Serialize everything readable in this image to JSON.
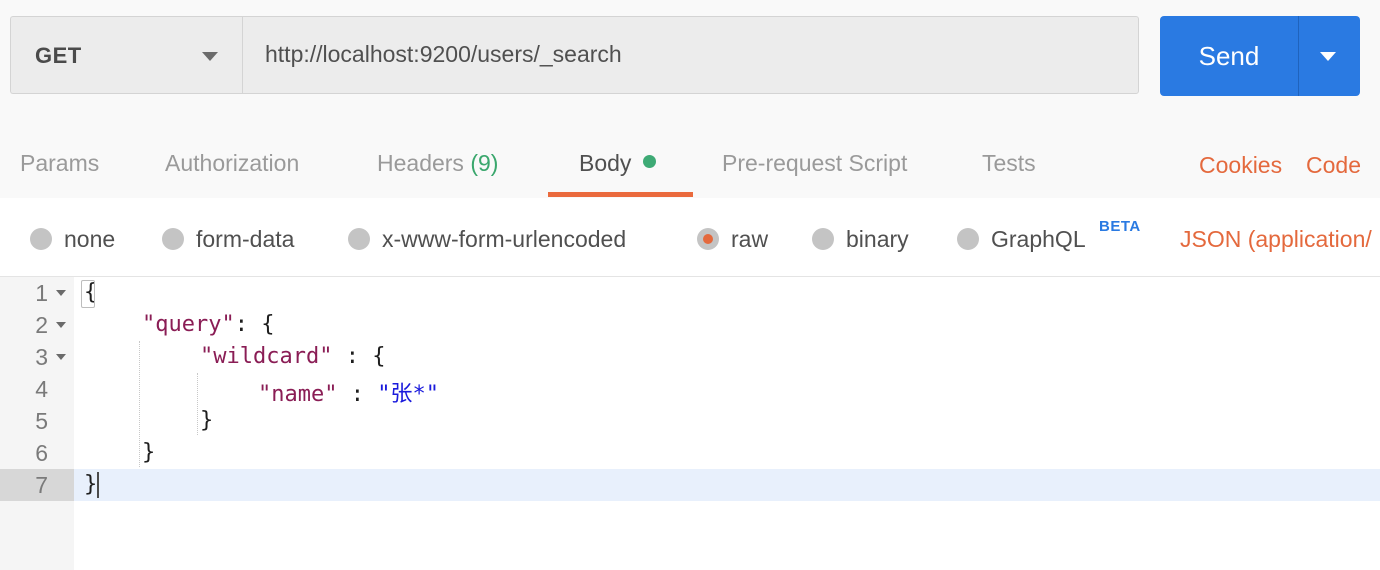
{
  "request": {
    "method": "GET",
    "url": "http://localhost:9200/users/_search",
    "send_label": "Send"
  },
  "tabs": {
    "items": [
      {
        "label": "Params"
      },
      {
        "label": "Authorization"
      },
      {
        "label": "Headers",
        "count": "(9)"
      },
      {
        "label": "Body",
        "active": true
      },
      {
        "label": "Pre-request Script"
      },
      {
        "label": "Tests"
      }
    ],
    "cookies": "Cookies",
    "code": "Code"
  },
  "body_options": {
    "items": [
      "none",
      "form-data",
      "x-www-form-urlencoded",
      "raw",
      "binary",
      "GraphQL"
    ],
    "selected": "raw",
    "beta_badge": "BETA",
    "content_type": "JSON (application/"
  },
  "editor": {
    "lines": [
      {
        "n": "1",
        "text": "{"
      },
      {
        "n": "2",
        "key": "\"query\"",
        "rest": ": {"
      },
      {
        "n": "3",
        "key": "\"wildcard\"",
        "rest": " : {"
      },
      {
        "n": "4",
        "key": "\"name\"",
        "mid": " : ",
        "value": "\"张*\""
      },
      {
        "n": "5",
        "text": "}"
      },
      {
        "n": "6",
        "text": "}"
      },
      {
        "n": "7",
        "text": "}"
      }
    ]
  },
  "colors": {
    "accent": "#e4693d",
    "send": "#2a7ae2",
    "status_green": "#3eaa75",
    "json_key": "#8a1d55",
    "json_string": "#1a1adc"
  }
}
